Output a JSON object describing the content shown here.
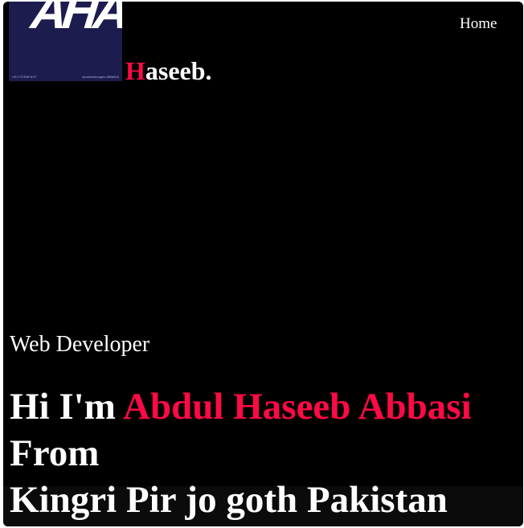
{
  "logo": {
    "text": "AHA",
    "footer_left": "VECTOR8FAST",
    "footer_right": "stockfreeimages 8858815"
  },
  "brand": {
    "first_letter": "H",
    "rest": "aseeb."
  },
  "nav": {
    "home_label": "Home"
  },
  "hero": {
    "role": "Web Developer",
    "greeting": "Hi I'm",
    "name": "Abdul Haseeb Abbasi",
    "line2": "From",
    "line3": "Kingri Pir jo goth Pakistan"
  },
  "colors": {
    "background": "#000000",
    "accent": "#ff0a45",
    "text": "#ffffff",
    "logo_background": "#1c1c4e"
  }
}
